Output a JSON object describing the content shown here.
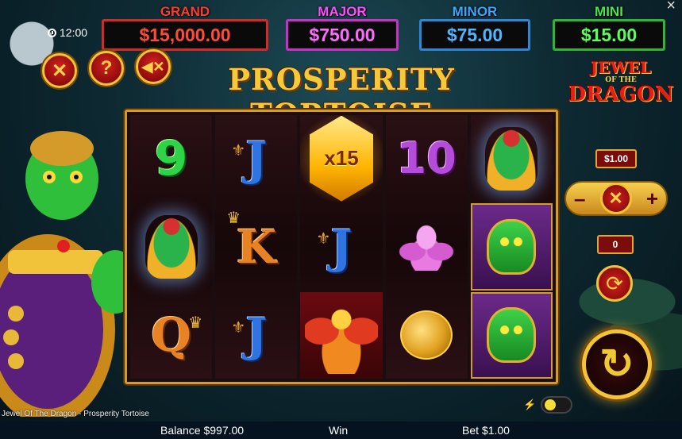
{
  "jackpots": {
    "grand": {
      "label": "GRAND",
      "value": "$15,000.00"
    },
    "major": {
      "label": "MAJOR",
      "value": "$750.00"
    },
    "minor": {
      "label": "MINOR",
      "value": "$75.00"
    },
    "mini": {
      "label": "MINI",
      "value": "$15.00"
    }
  },
  "clock": "12:00",
  "buttons": {
    "close": "✕",
    "help": "?",
    "mute": "◀✕"
  },
  "title": "PROSPERITY TORTOISE",
  "logo": {
    "line1": "JEWEL",
    "line2": "OF THE",
    "line3": "DRAGON"
  },
  "reels": [
    [
      {
        "type": "number",
        "value": "9",
        "icon": "nine-symbol"
      },
      {
        "type": "tortoise",
        "icon": "tortoise-stack-symbol"
      },
      {
        "type": "letter",
        "value": "Q",
        "icon": "queen-symbol"
      }
    ],
    [
      {
        "type": "letter",
        "value": "J",
        "icon": "jack-symbol"
      },
      {
        "type": "letter",
        "value": "K",
        "icon": "king-symbol"
      },
      {
        "type": "letter",
        "value": "J",
        "icon": "jack-symbol"
      }
    ],
    [
      {
        "type": "gem",
        "value": "x15",
        "icon": "gem-multiplier-symbol"
      },
      {
        "type": "letter",
        "value": "J",
        "icon": "jack-symbol"
      },
      {
        "type": "phoenix",
        "icon": "phoenix-symbol"
      }
    ],
    [
      {
        "type": "number",
        "value": "10",
        "icon": "ten-symbol"
      },
      {
        "type": "lotus",
        "icon": "lotus-symbol"
      },
      {
        "type": "koi",
        "icon": "koi-symbol"
      }
    ],
    [
      {
        "type": "tortoise",
        "icon": "tortoise-stack-symbol"
      },
      {
        "type": "wild",
        "icon": "tortoise-wild-symbol"
      },
      {
        "type": "wild",
        "icon": "tortoise-wild-symbol"
      }
    ]
  ],
  "bet_control": {
    "value": "$1.00",
    "minus": "–",
    "center": "✕",
    "plus": "+"
  },
  "autospin_count": "0",
  "game_name": "Jewel Of The Dragon - Prosperity Tortoise",
  "status": {
    "balance": "Balance $997.00",
    "win": "Win",
    "bet": "Bet $1.00"
  },
  "colors": {
    "grand": "#ff3b30",
    "major": "#ff4dff",
    "minor": "#38a8ff",
    "mini": "#47e64a",
    "gold": "#f3c33a"
  }
}
